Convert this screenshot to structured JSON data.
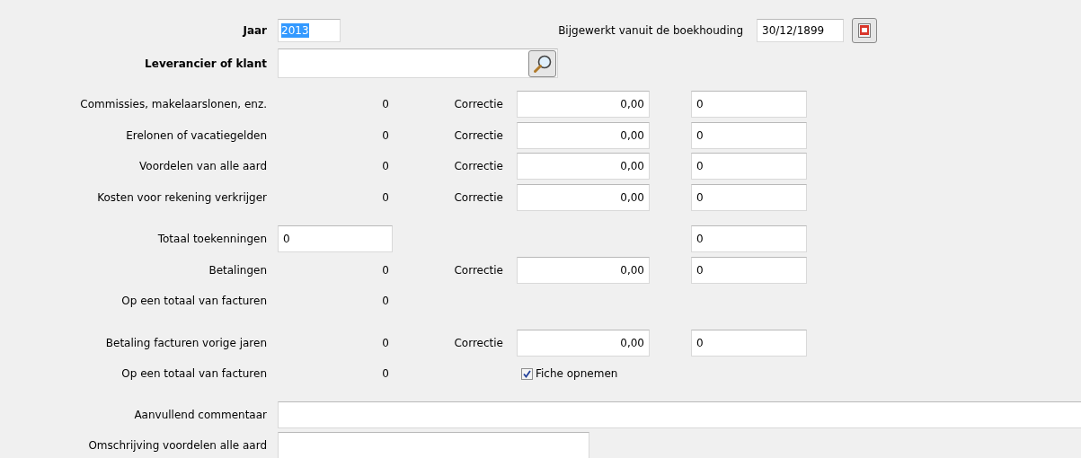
{
  "header": {
    "year": {
      "label": "Jaar",
      "value": "2013",
      "selected": true
    },
    "updated": {
      "label": "Bijgewerkt vanuit de boekhouding",
      "value": "30/12/1899"
    },
    "supplier": {
      "label": "Leverancier of klant"
    }
  },
  "sections": [
    [
      {
        "kind": "amount",
        "label": "Commissies, makelaarslonen, enz.",
        "value": "0",
        "correction_label": "Correctie",
        "correction": "0,00",
        "result": "0"
      },
      {
        "kind": "amount",
        "label": "Erelonen of vacatiegelden",
        "value": "0",
        "correction_label": "Correctie",
        "correction": "0,00",
        "result": "0"
      },
      {
        "kind": "amount",
        "label": "Voordelen van alle aard",
        "value": "0",
        "correction_label": "Correctie",
        "correction": "0,00",
        "result": "0"
      },
      {
        "kind": "amount",
        "label": "Kosten voor rekening verkrijger",
        "value": "0",
        "correction_label": "Correctie",
        "correction": "0,00",
        "result": "0"
      }
    ],
    [
      {
        "kind": "total",
        "label": "Totaal toekenningen",
        "field": "0",
        "result": "0"
      },
      {
        "kind": "amount",
        "label": "Betalingen",
        "value": "0",
        "correction_label": "Correctie",
        "correction": "0,00",
        "result": "0"
      },
      {
        "kind": "count",
        "label": "Op een totaal van facturen",
        "value": "0"
      }
    ],
    [
      {
        "kind": "amount",
        "label": "Betaling facturen vorige jaren",
        "value": "0",
        "correction_label": "Correctie",
        "correction": "0,00",
        "result": "0"
      },
      {
        "kind": "count",
        "label": "Op een totaal van facturen",
        "value": "0",
        "checkbox": {
          "label": "Fiche opnemen",
          "checked": true
        }
      }
    ],
    [
      {
        "kind": "comment",
        "label": "Aanvullend commentaar"
      },
      {
        "kind": "text",
        "label": "Omschrijving voordelen alle aard"
      }
    ]
  ]
}
